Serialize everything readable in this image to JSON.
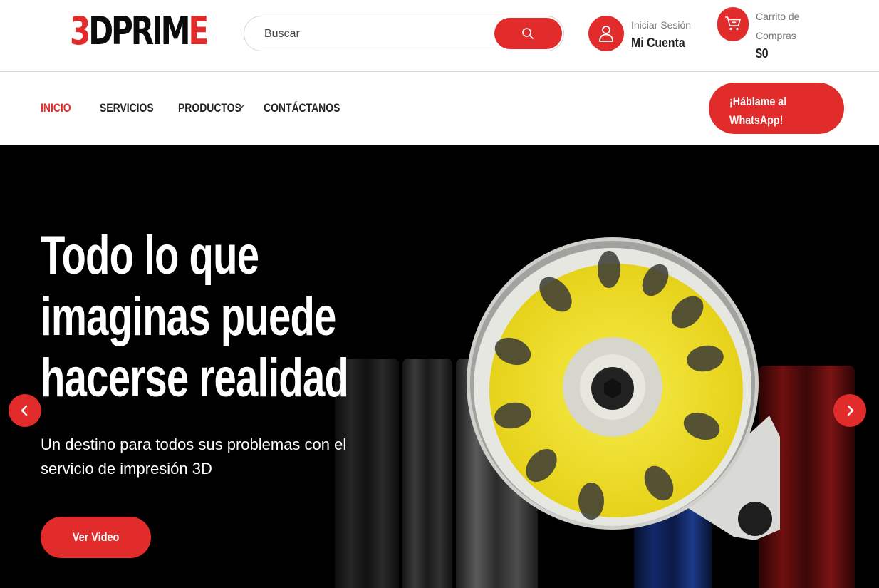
{
  "brand": {
    "logo_mark": "3",
    "logo_text": "DPRIM",
    "logo_last": "E"
  },
  "search": {
    "placeholder": "Buscar"
  },
  "account": {
    "label_small": "Iniciar Sesión",
    "label_big": "Mi Cuenta"
  },
  "cart": {
    "line1": "Carrito de",
    "line2": "Compras",
    "total": "$0"
  },
  "nav": {
    "items": [
      "INICIO",
      "SERVICIOS",
      "PRODUCTOS",
      "CONTÁCTANOS"
    ],
    "whatsapp": "¡Háblame al WhatsApp!"
  },
  "hero": {
    "title": "Todo lo que imaginas puede hacerse realidad",
    "subtitle": "Un destino para todos sus problemas con el servicio de impresión 3D",
    "button": "Ver Video"
  },
  "colors": {
    "accent": "#e22b2b",
    "hero_bg": "#000000",
    "text": "#222222"
  }
}
